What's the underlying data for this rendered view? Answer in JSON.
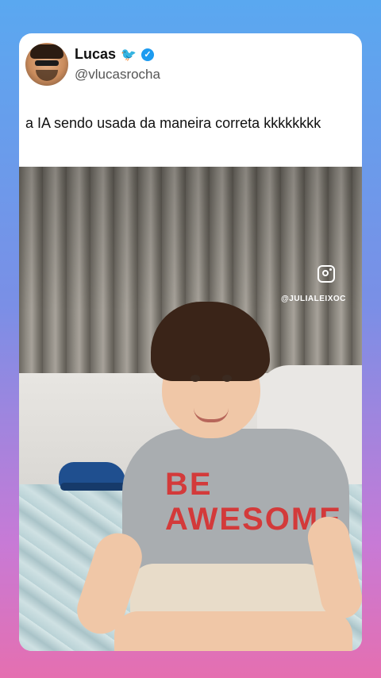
{
  "post": {
    "author_name": "Lucas",
    "author_handle": "@vlucasrocha",
    "text": "a IA sendo usada da maneira correta kkkkkkkk",
    "verified_color": "#1d9bf0"
  },
  "media": {
    "watermark": "@JULIALEIXOC",
    "shirt_print": "BE\nAWESOME"
  },
  "icons": {
    "name_emoji": "bird-icon",
    "verified": "verified-badge-icon",
    "instagram": "instagram-icon"
  }
}
